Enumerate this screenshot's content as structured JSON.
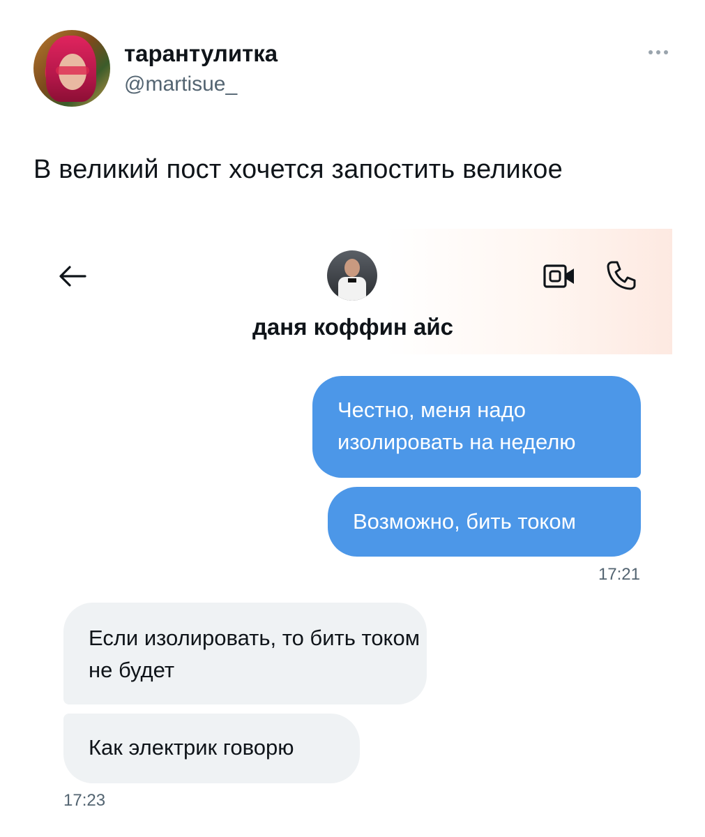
{
  "tweet": {
    "display_name": "тарантулитка",
    "handle": "@martisue_",
    "text": "В великий пост хочется запостить великое",
    "more_icon": "more-dots-icon"
  },
  "chat": {
    "contact_name": "даня коффин айс",
    "icons": [
      "back-arrow-icon",
      "video-call-icon",
      "phone-icon"
    ],
    "messages": [
      {
        "direction": "outgoing",
        "text": "Честно, меня надо изолировать на неделю"
      },
      {
        "direction": "outgoing",
        "text": "Возможно, бить током"
      },
      {
        "direction": "incoming",
        "text": "Если изолировать, то бить током не будет"
      },
      {
        "direction": "incoming",
        "text": "Как электрик говорю"
      }
    ],
    "timestamps": [
      "17:21",
      "17:23"
    ],
    "colors": {
      "outgoing_bubble": "#4c97e8",
      "incoming_bubble": "#eff2f4"
    }
  }
}
